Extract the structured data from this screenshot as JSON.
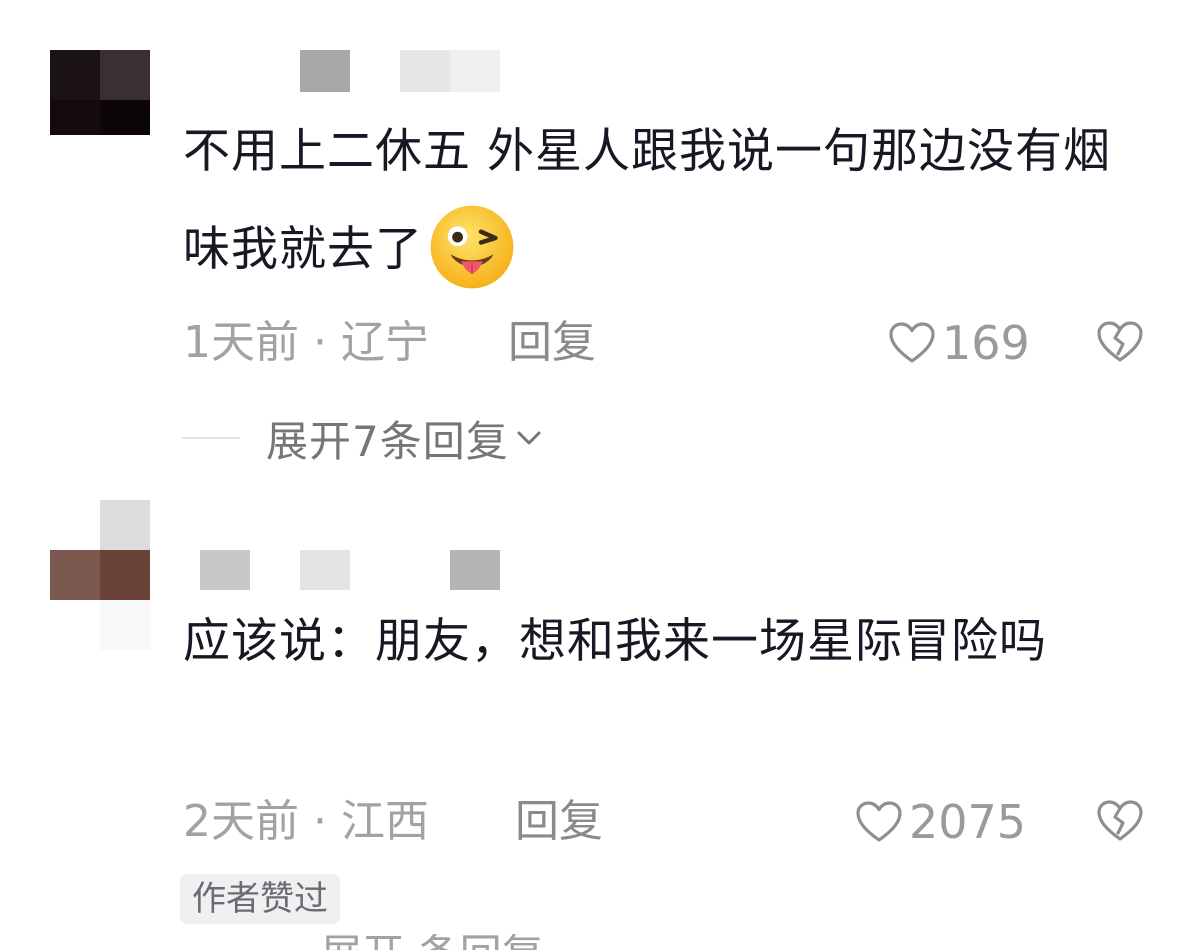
{
  "comments": [
    {
      "text": "不用上二休五 外星人跟我说一句那边没有烟味我就去了",
      "emoji": "squinting-tongue-emoji",
      "time": "1天前",
      "separator": "·",
      "location": "辽宁",
      "reply_label": "回复",
      "likes": "169",
      "expand_label": "展开7条回复"
    },
    {
      "text": "应该说：朋友，想和我来一场星际冒险吗",
      "time": "2天前",
      "separator": "·",
      "location": "江西",
      "reply_label": "回复",
      "likes": "2075",
      "badge": "作者赞过"
    }
  ],
  "colors": {
    "text": "#161823",
    "meta": "#a1a1a6",
    "badge_bg": "#f0f0f2"
  },
  "icons": {
    "like": "heart-outline-icon",
    "dislike": "broken-heart-icon",
    "expand": "chevron-down-icon"
  }
}
